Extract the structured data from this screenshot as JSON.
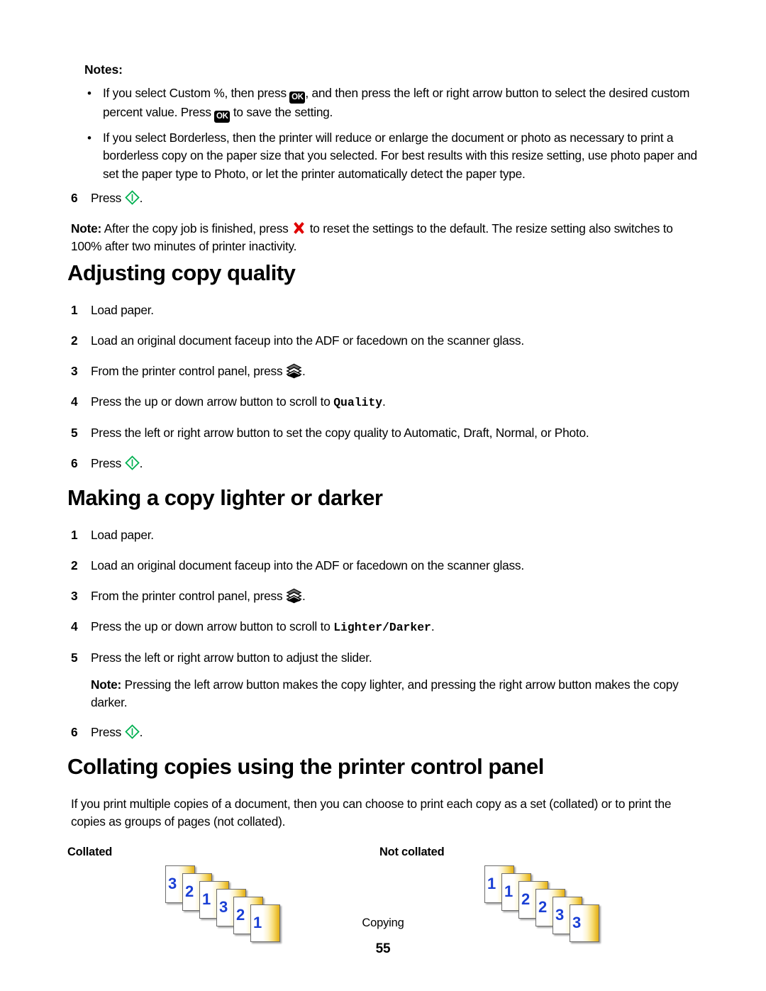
{
  "document": {
    "chapter_footer": "Copying",
    "page_number": "55"
  },
  "notes_block": {
    "label": "Notes:",
    "items": [
      {
        "part1": "If you select Custom %, then press ",
        "icon1": "ok-button-icon",
        "part2": ", and then press the left or right arrow button to select the desired custom percent value. Press ",
        "icon2": "ok-button-icon",
        "part3": " to save the setting."
      },
      {
        "part1": "If you select Borderless, then the printer will reduce or enlarge the document or photo as necessary to print a borderless copy on the paper size that you selected. For best results with this resize setting, use photo paper and set the paper type to Photo, or let the printer automatically detect the paper type."
      }
    ],
    "final_step": {
      "num": "6",
      "text_before": "Press ",
      "icon": "start-button-icon",
      "text_after": "."
    },
    "trailing_note": {
      "label": "Note:",
      "text_before": " After the copy job is finished, press ",
      "icon": "cancel-button-icon",
      "text_after": " to reset the settings to the default. The resize setting also switches to 100% after two minutes of printer inactivity."
    }
  },
  "section_quality": {
    "heading": "Adjusting copy quality",
    "steps": [
      {
        "num": "1",
        "text": "Load paper."
      },
      {
        "num": "2",
        "text": "Load an original document faceup into the ADF or facedown on the scanner glass."
      },
      {
        "num": "3",
        "text_before": "From the printer control panel, press ",
        "icon": "copy-button-icon",
        "text_after": "."
      },
      {
        "num": "4",
        "text_before": "Press the up or down arrow button to scroll to ",
        "mono": "Quality",
        "text_after": "."
      },
      {
        "num": "5",
        "text": "Press the left or right arrow button to set the copy quality to Automatic, Draft, Normal, or Photo."
      },
      {
        "num": "6",
        "text_before": "Press ",
        "icon": "start-button-icon",
        "text_after": "."
      }
    ]
  },
  "section_lighter_darker": {
    "heading": "Making a copy lighter or darker",
    "steps": [
      {
        "num": "1",
        "text": "Load paper."
      },
      {
        "num": "2",
        "text": "Load an original document faceup into the ADF or facedown on the scanner glass."
      },
      {
        "num": "3",
        "text_before": "From the printer control panel, press ",
        "icon": "copy-button-icon",
        "text_after": "."
      },
      {
        "num": "4",
        "text_before": "Press the up or down arrow button to scroll to ",
        "mono": "Lighter/Darker",
        "text_after": "."
      },
      {
        "num": "5",
        "text": "Press the left or right arrow button to adjust the slider."
      }
    ],
    "note": {
      "label": "Note:",
      "text": " Pressing the left arrow button makes the copy lighter, and pressing the right arrow button makes the copy darker."
    },
    "final_step": {
      "num": "6",
      "text_before": "Press ",
      "icon": "start-button-icon",
      "text_after": "."
    }
  },
  "section_collating": {
    "heading": "Collating copies using the printer control panel",
    "intro": "If you print multiple copies of a document, then you can choose to print each copy as a set (collated) or to print the copies as groups of pages (not collated).",
    "collated_label": "Collated",
    "not_collated_label": "Not collated",
    "collated_pages": [
      "3",
      "2",
      "1",
      "3",
      "2",
      "1"
    ],
    "not_collated_pages": [
      "1",
      "1",
      "2",
      "2",
      "3",
      "3"
    ]
  },
  "icons": {
    "ok_label": "OK",
    "start_color": "#00b050",
    "cancel_color": "#e00000",
    "page_number_color": "#1a3fd4",
    "sheet_accent_color": "#e9b824"
  }
}
